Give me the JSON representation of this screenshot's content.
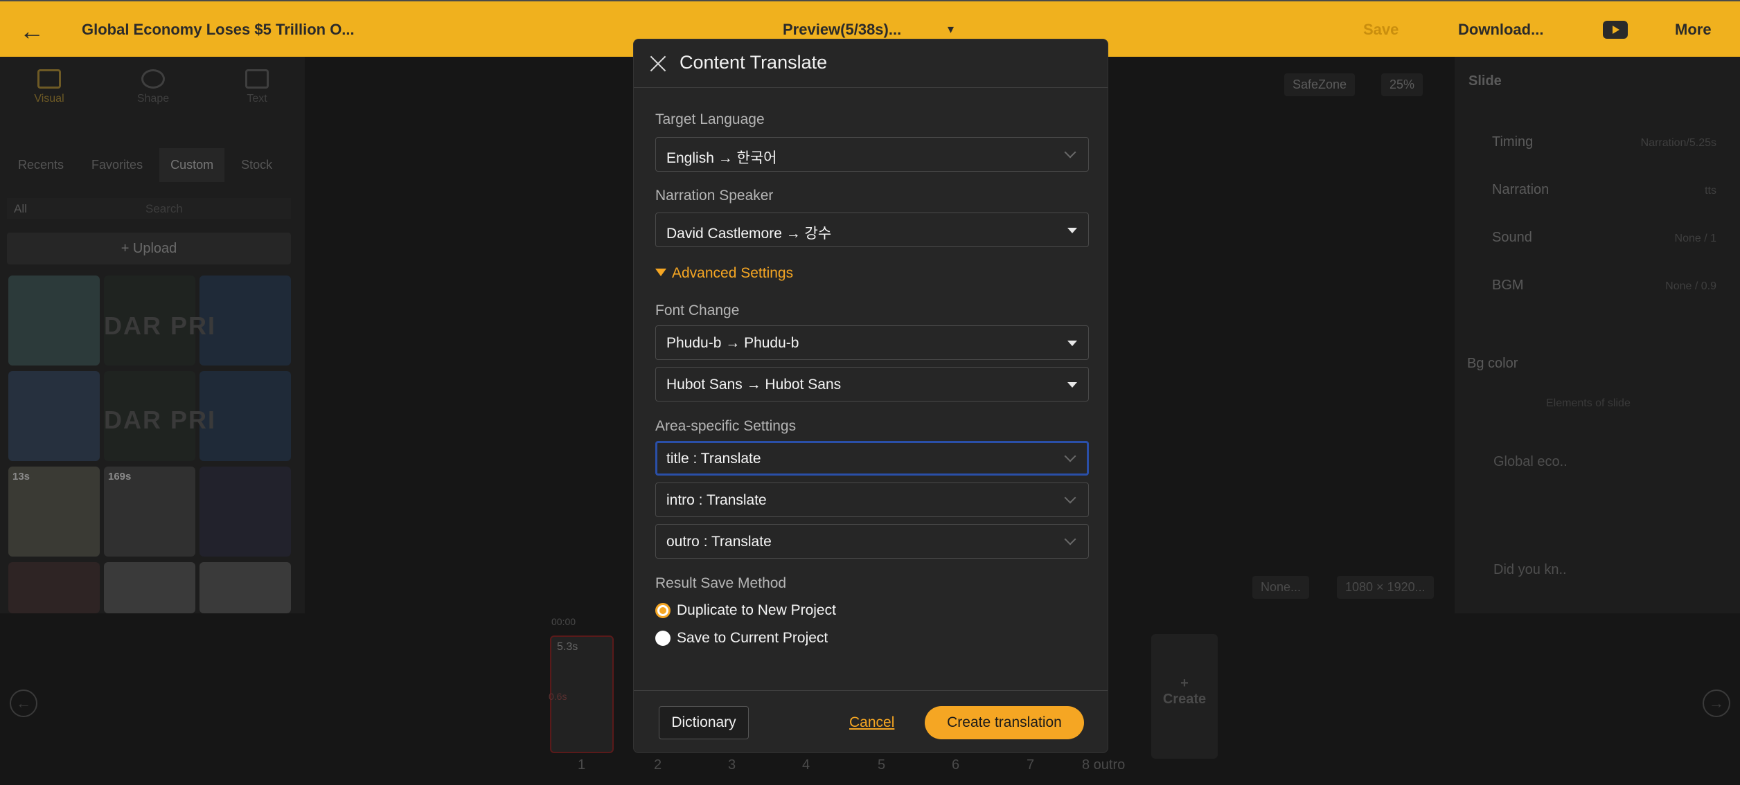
{
  "topbar": {
    "back_icon": "arrow-left-icon",
    "project_title": "Global Economy Loses $5 Trillion O...",
    "preview": "Preview(5/38s)...",
    "save": "Save",
    "download": "Download...",
    "more": "More"
  },
  "left_panel": {
    "tools": [
      "Visual",
      "Shape",
      "Text"
    ],
    "subtabs": [
      "Recents",
      "Favorites",
      "Custom",
      "Stock"
    ],
    "filter": "All",
    "search_placeholder": "Search",
    "upload": "+ Upload",
    "thumbs": [
      {
        "badge": "13s"
      },
      {
        "badge": "169s"
      }
    ],
    "overlay_text": "DAR PRI"
  },
  "canvas": {
    "safezone": "SafeZone",
    "zoom": "25%",
    "bgm_chip": "None...",
    "size_chip": "1080 × 1920..."
  },
  "right_panel": {
    "heading": "Slide",
    "rows": [
      {
        "label": "Timing",
        "value": "Narration/5.25s"
      },
      {
        "label": "Narration",
        "value": "tts"
      },
      {
        "label": "Sound",
        "value": "None / 1"
      },
      {
        "label": "BGM",
        "value": "None / 0.9"
      }
    ],
    "bg_color_label": "Bg color",
    "elements_label": "Elements of slide",
    "elements": [
      "Global eco..",
      "Did you kn.."
    ]
  },
  "timeline": {
    "time": "00:00",
    "slide_numbers": [
      "1",
      "2",
      "3",
      "4",
      "5",
      "6",
      "7",
      "8 outro"
    ],
    "first_slide_duration": "5.3s",
    "first_slide_sub": "0.6s",
    "create": "Create"
  },
  "modal": {
    "title": "Content Translate",
    "target_language_label": "Target Language",
    "target_language_value": "English → 한국어",
    "narration_speaker_label": "Narration Speaker",
    "narration_speaker_value": "David Castlemore → 강수",
    "advanced_settings": "Advanced Settings",
    "font_change_label": "Font Change",
    "font_changes": [
      "Phudu-b → Phudu-b",
      "Hubot Sans → Hubot Sans"
    ],
    "area_settings_label": "Area-specific Settings",
    "areas": [
      "title : Translate",
      "intro : Translate",
      "outro : Translate"
    ],
    "result_save_label": "Result Save Method",
    "save_options": [
      "Duplicate to New Project",
      "Save to Current Project"
    ],
    "selected_save_option": "Duplicate to New Project",
    "dictionary_button": "Dictionary",
    "cancel_button": "Cancel",
    "create_button": "Create translation"
  }
}
